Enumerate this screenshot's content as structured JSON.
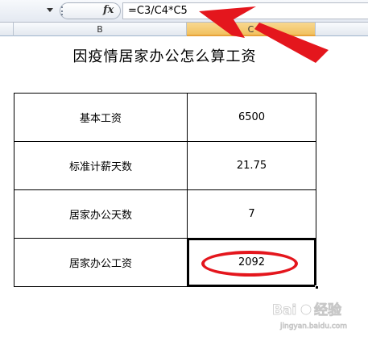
{
  "formula_bar": {
    "fx_label": "fx",
    "formula": "=C3/C4*C5"
  },
  "columns": {
    "b": "B",
    "c": "C"
  },
  "sheet": {
    "title": "因疫情居家办公怎么算工资",
    "rows": [
      {
        "label": "基本工资",
        "value": "6500"
      },
      {
        "label": "标准计薪天数",
        "value": "21.75"
      },
      {
        "label": "居家办公天数",
        "value": "7"
      },
      {
        "label": "居家办公工资",
        "value": "2092"
      }
    ]
  },
  "annotation": {
    "color": "#e4161d"
  }
}
